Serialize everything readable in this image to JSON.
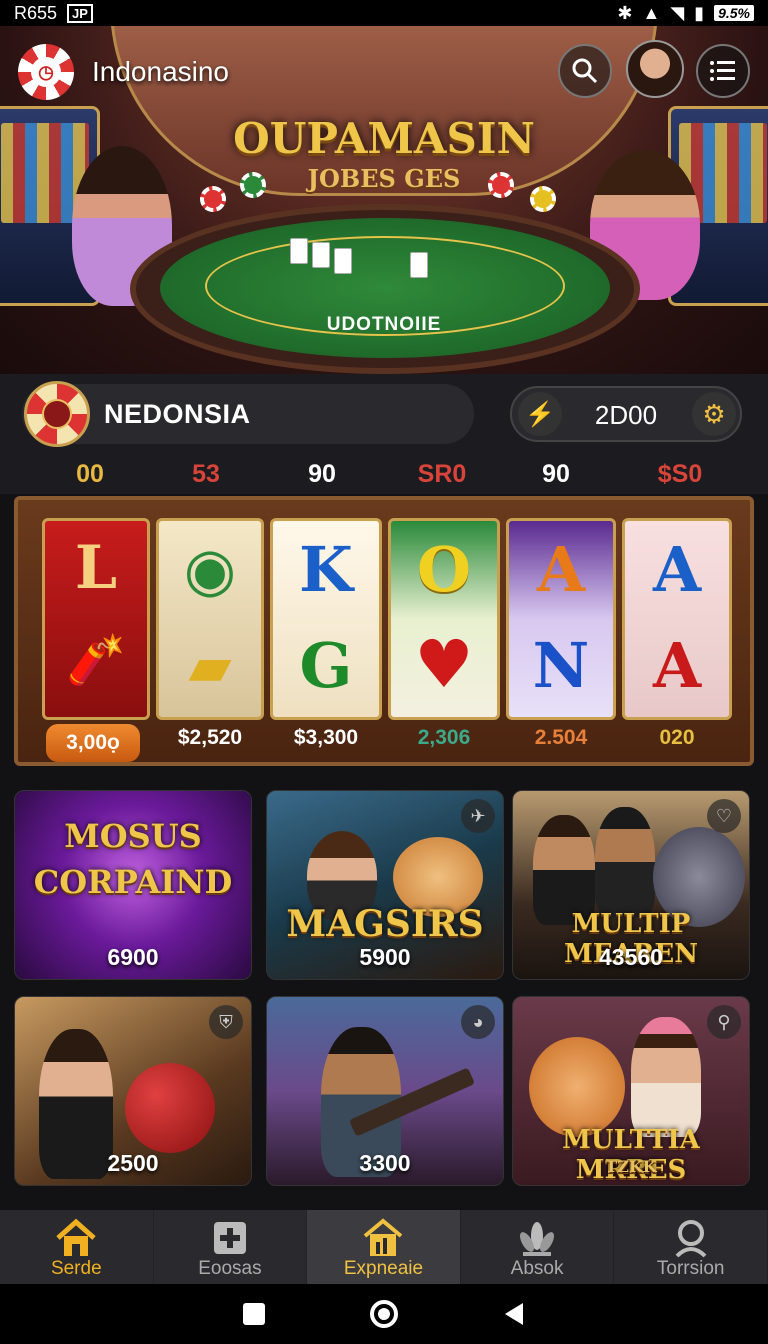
{
  "status_bar": {
    "left_text": "R655",
    "box_text": "JP",
    "battery": "9.5%"
  },
  "app": {
    "brand_name": "Indonasino"
  },
  "hero": {
    "title": "OUPAMASIN",
    "subtitle": "JOBES GES",
    "table_text": "UDOTNOIIE"
  },
  "user": {
    "name": "NEDONSIA",
    "balance": "2D00"
  },
  "stats": [
    "00",
    "53",
    "90",
    "SR0",
    "90",
    "$S0"
  ],
  "stat_colors": [
    "#e8b840",
    "#d9443a",
    "#ffffff",
    "#d9443a",
    "#ffffff",
    "#d9443a"
  ],
  "reels": [
    {
      "top": "L",
      "bottom": "🧨"
    },
    {
      "top": "◉",
      "bottom": "▰"
    },
    {
      "top": "K",
      "bottom": "G"
    },
    {
      "top": "O",
      "bottom": "♥"
    },
    {
      "top": "A",
      "bottom": "N"
    },
    {
      "top": "A",
      "bottom": "A"
    }
  ],
  "reel_amounts": [
    "3,00ọ",
    "$2,520",
    "$3,300",
    "2,306",
    "2.504",
    "020"
  ],
  "tiles": [
    {
      "title": "MOSUS CORPAIND",
      "value": "6900",
      "icon": ""
    },
    {
      "title": "MAGSIRS",
      "value": "5900",
      "icon": "pin-icon"
    },
    {
      "title": "MULTIP MEAREN",
      "value": "43560",
      "icon": "heart-icon"
    },
    {
      "title": "",
      "value": "2500",
      "icon": "shield-icon"
    },
    {
      "title": "",
      "value": "3300",
      "icon": "mask-icon"
    },
    {
      "title": "MULTTIA MRRES",
      "subtitle": "TZKK",
      "value": "",
      "icon": "link-icon"
    }
  ],
  "nav": [
    {
      "label": "Serde",
      "icon": "home-icon"
    },
    {
      "label": "Eoosas",
      "icon": "plus-box-icon"
    },
    {
      "label": "Expneaie",
      "icon": "house-chart-icon",
      "active": true
    },
    {
      "label": "Absok",
      "icon": "lotus-icon"
    },
    {
      "label": "Torrsion",
      "icon": "search-person-icon"
    }
  ],
  "colors": {
    "accent": "#f0c64a",
    "background": "#121215",
    "panel": "#2a2a2e"
  }
}
